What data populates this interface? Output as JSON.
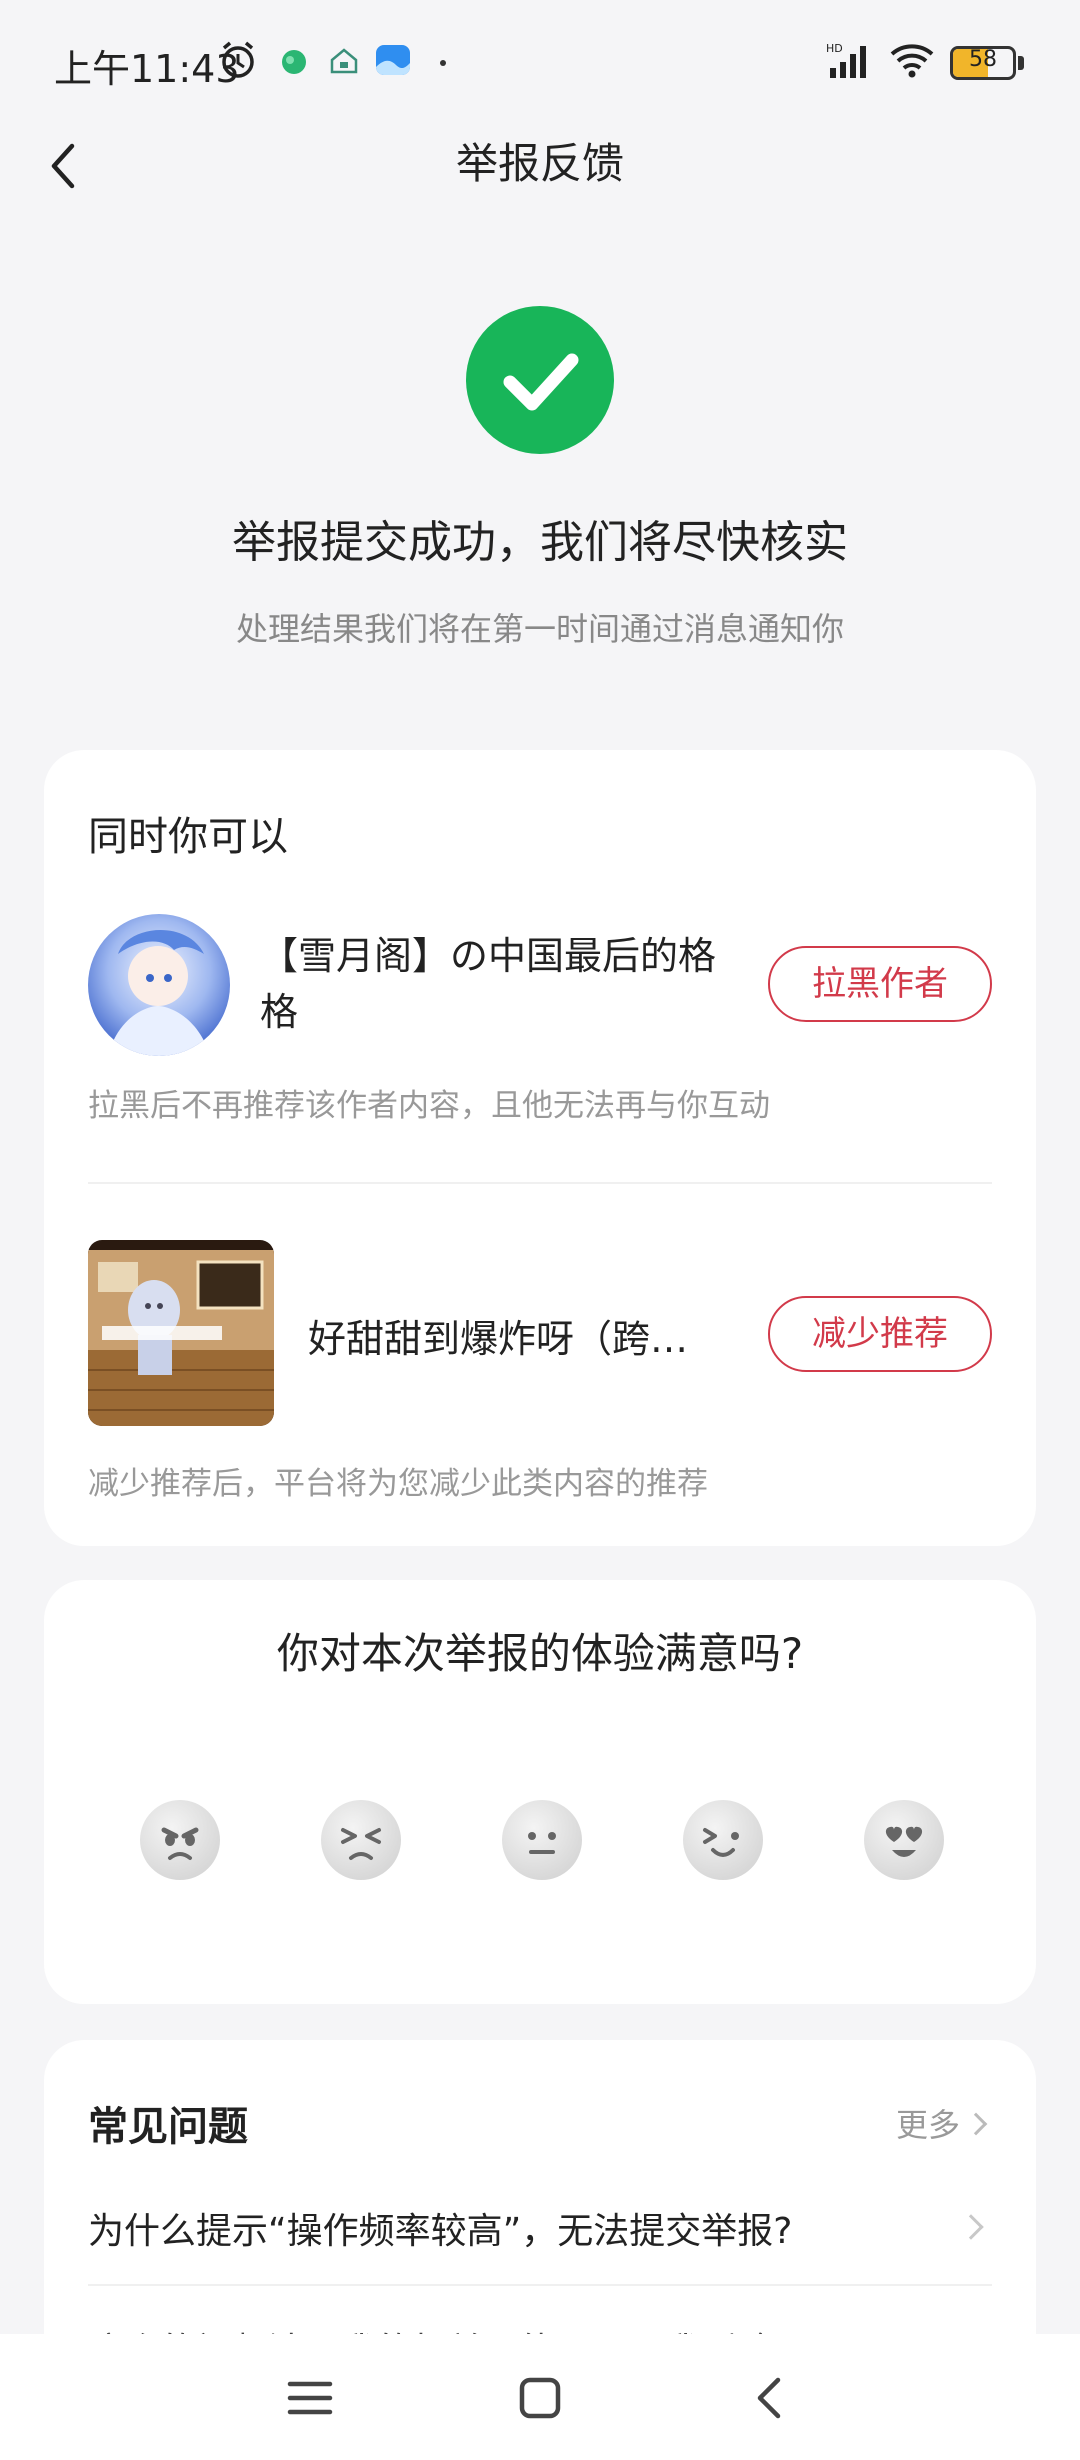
{
  "status_bar": {
    "time": "上午11:43",
    "battery": "58",
    "battery_level": 0.58,
    "icons": [
      "alarm-icon",
      "app-notification-icon",
      "home-app-icon",
      "gallery-app-icon",
      "more-dot-icon",
      "hd-signal-icon",
      "wifi-icon",
      "battery-icon"
    ]
  },
  "header": {
    "title": "举报反馈"
  },
  "success": {
    "title": "举报提交成功，我们将尽快核实",
    "subtitle": "处理结果我们将在第一时间通过消息通知你",
    "color": "#18b559"
  },
  "actions": {
    "title": "同时你可以",
    "author": {
      "name": "【雪月阁】の中国最后的格格",
      "button": "拉黑作者",
      "description": "拉黑后不再推荐该作者内容，且他无法再与你互动"
    },
    "video": {
      "title": "好甜甜到爆炸呀（跨…",
      "button": "减少推荐",
      "description": "减少推荐后，平台将为您减少此类内容的推荐"
    },
    "accent_color": "#d23a4a"
  },
  "survey": {
    "question": "你对本次举报的体验满意吗?",
    "ratings": [
      "angry-face-icon",
      "sad-face-icon",
      "neutral-face-icon",
      "smile-face-icon",
      "heart-eyes-face-icon"
    ]
  },
  "faq": {
    "title": "常见问题",
    "more": "更多",
    "items": [
      "为什么提示“操作频率较高”，无法提交举报?",
      "这个的视频涉及我的权益，能否需要我删除"
    ]
  },
  "nav": {
    "icons": [
      "menu-icon",
      "home-icon",
      "back-icon"
    ]
  }
}
